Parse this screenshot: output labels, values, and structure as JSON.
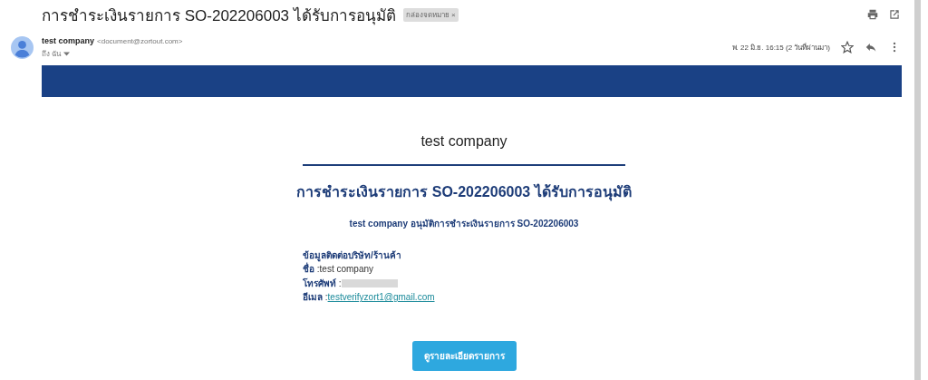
{
  "subject": "การชำระเงินรายการ SO-202206003 ได้รับการอนุมัติ",
  "label": {
    "text": "กล่องจดหมาย",
    "close": "×"
  },
  "sender": {
    "name": "test company",
    "email": "<document@zortout.com>",
    "to": "ถึง ฉัน",
    "date": "พ. 22 มิ.ย. 16:15 (2 วันที่ผ่านมา)",
    "starred": false
  },
  "body": {
    "company": "test company",
    "heading": "การชำระเงินรายการ SO-202206003 ได้รับการอนุมัติ",
    "subheading": "test company อนุมัติการชำระเงินรายการ SO-202206003",
    "contact_title": "ข้อมูลติดต่อบริษัท/ร้านค้า",
    "fields": [
      {
        "label": "ชื่อ",
        "sep": " : ",
        "value": "test company",
        "kind": "text"
      },
      {
        "label": "โทรศัพท์",
        "sep": " : ",
        "kind": "redacted"
      },
      {
        "label": "อีเมล",
        "sep": " : ",
        "value": "testverifyzort1@gmail.com",
        "kind": "link"
      }
    ],
    "button": "ดูรายละเอียดรายการ"
  }
}
